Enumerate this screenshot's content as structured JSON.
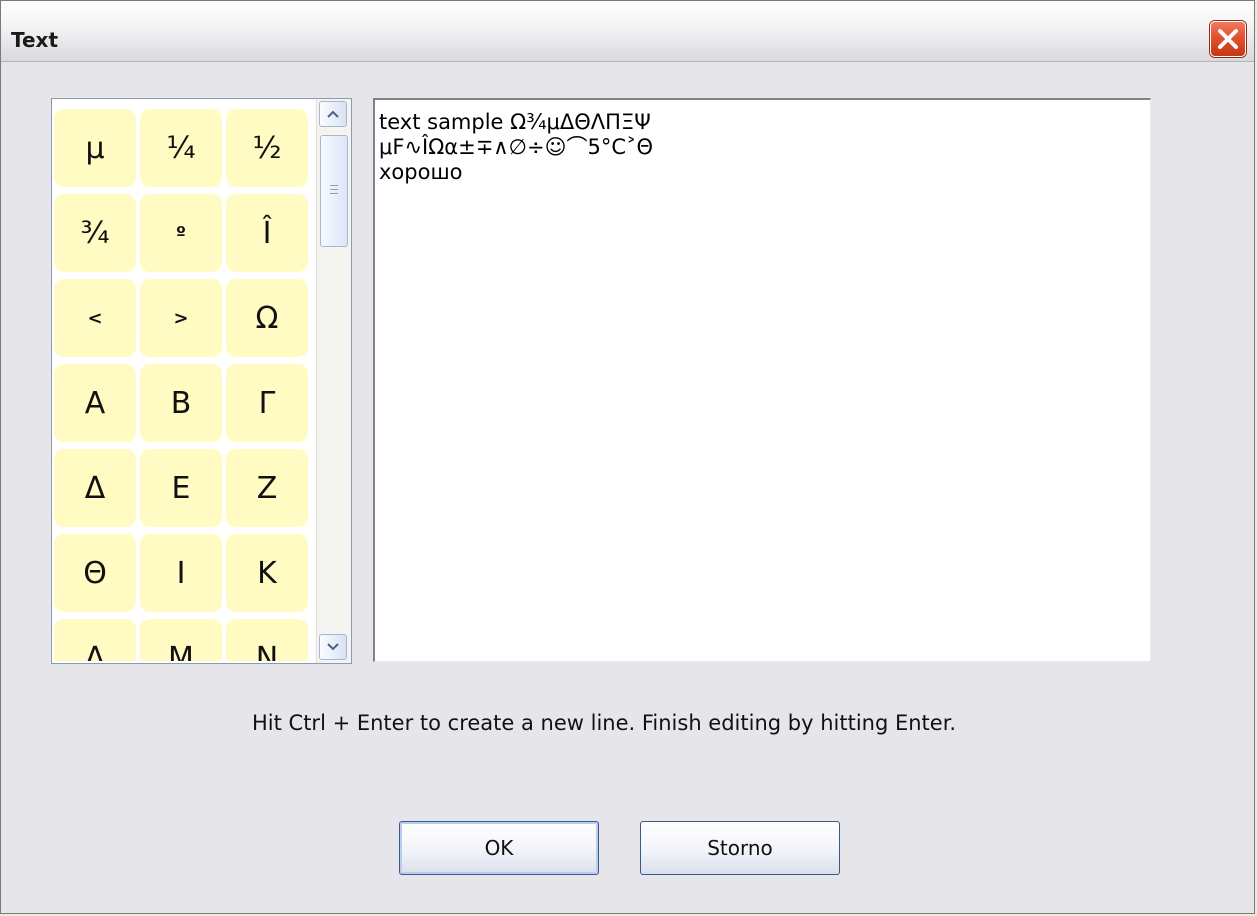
{
  "window": {
    "title": "Text"
  },
  "palette": {
    "symbols": [
      {
        "char": "μ",
        "size": "large"
      },
      {
        "char": "¼",
        "size": "large"
      },
      {
        "char": "½",
        "size": "large"
      },
      {
        "char": "¾",
        "size": "large"
      },
      {
        "char": "º",
        "size": "small"
      },
      {
        "char": "Î",
        "size": "large"
      },
      {
        "char": "<",
        "size": "small"
      },
      {
        "char": ">",
        "size": "small"
      },
      {
        "char": "Ω",
        "size": "large"
      },
      {
        "char": "Α",
        "size": "large"
      },
      {
        "char": "Β",
        "size": "large"
      },
      {
        "char": "Γ",
        "size": "large"
      },
      {
        "char": "Δ",
        "size": "large"
      },
      {
        "char": "Ε",
        "size": "large"
      },
      {
        "char": "Ζ",
        "size": "large"
      },
      {
        "char": "Θ",
        "size": "large"
      },
      {
        "char": "Ι",
        "size": "large"
      },
      {
        "char": "Κ",
        "size": "large"
      },
      {
        "char": "Λ",
        "size": "large"
      },
      {
        "char": "Μ",
        "size": "large"
      },
      {
        "char": "Ν",
        "size": "large"
      }
    ],
    "scroll_position": 0.0
  },
  "editor": {
    "lines": [
      "text sample Ω¾μΔΘΛΠΞΨ",
      "μF∿ÎΩα±∓∧∅÷☺⌒5°C˃Θ",
      "хорошо"
    ]
  },
  "hint": {
    "text": "Hit Ctrl + Enter to create a new line. Finish editing by hitting Enter."
  },
  "buttons": {
    "ok_label": "OK",
    "cancel_label": "Storno"
  },
  "colors": {
    "symbol_background": "#fffbc3",
    "close_button": "#e2512f"
  }
}
